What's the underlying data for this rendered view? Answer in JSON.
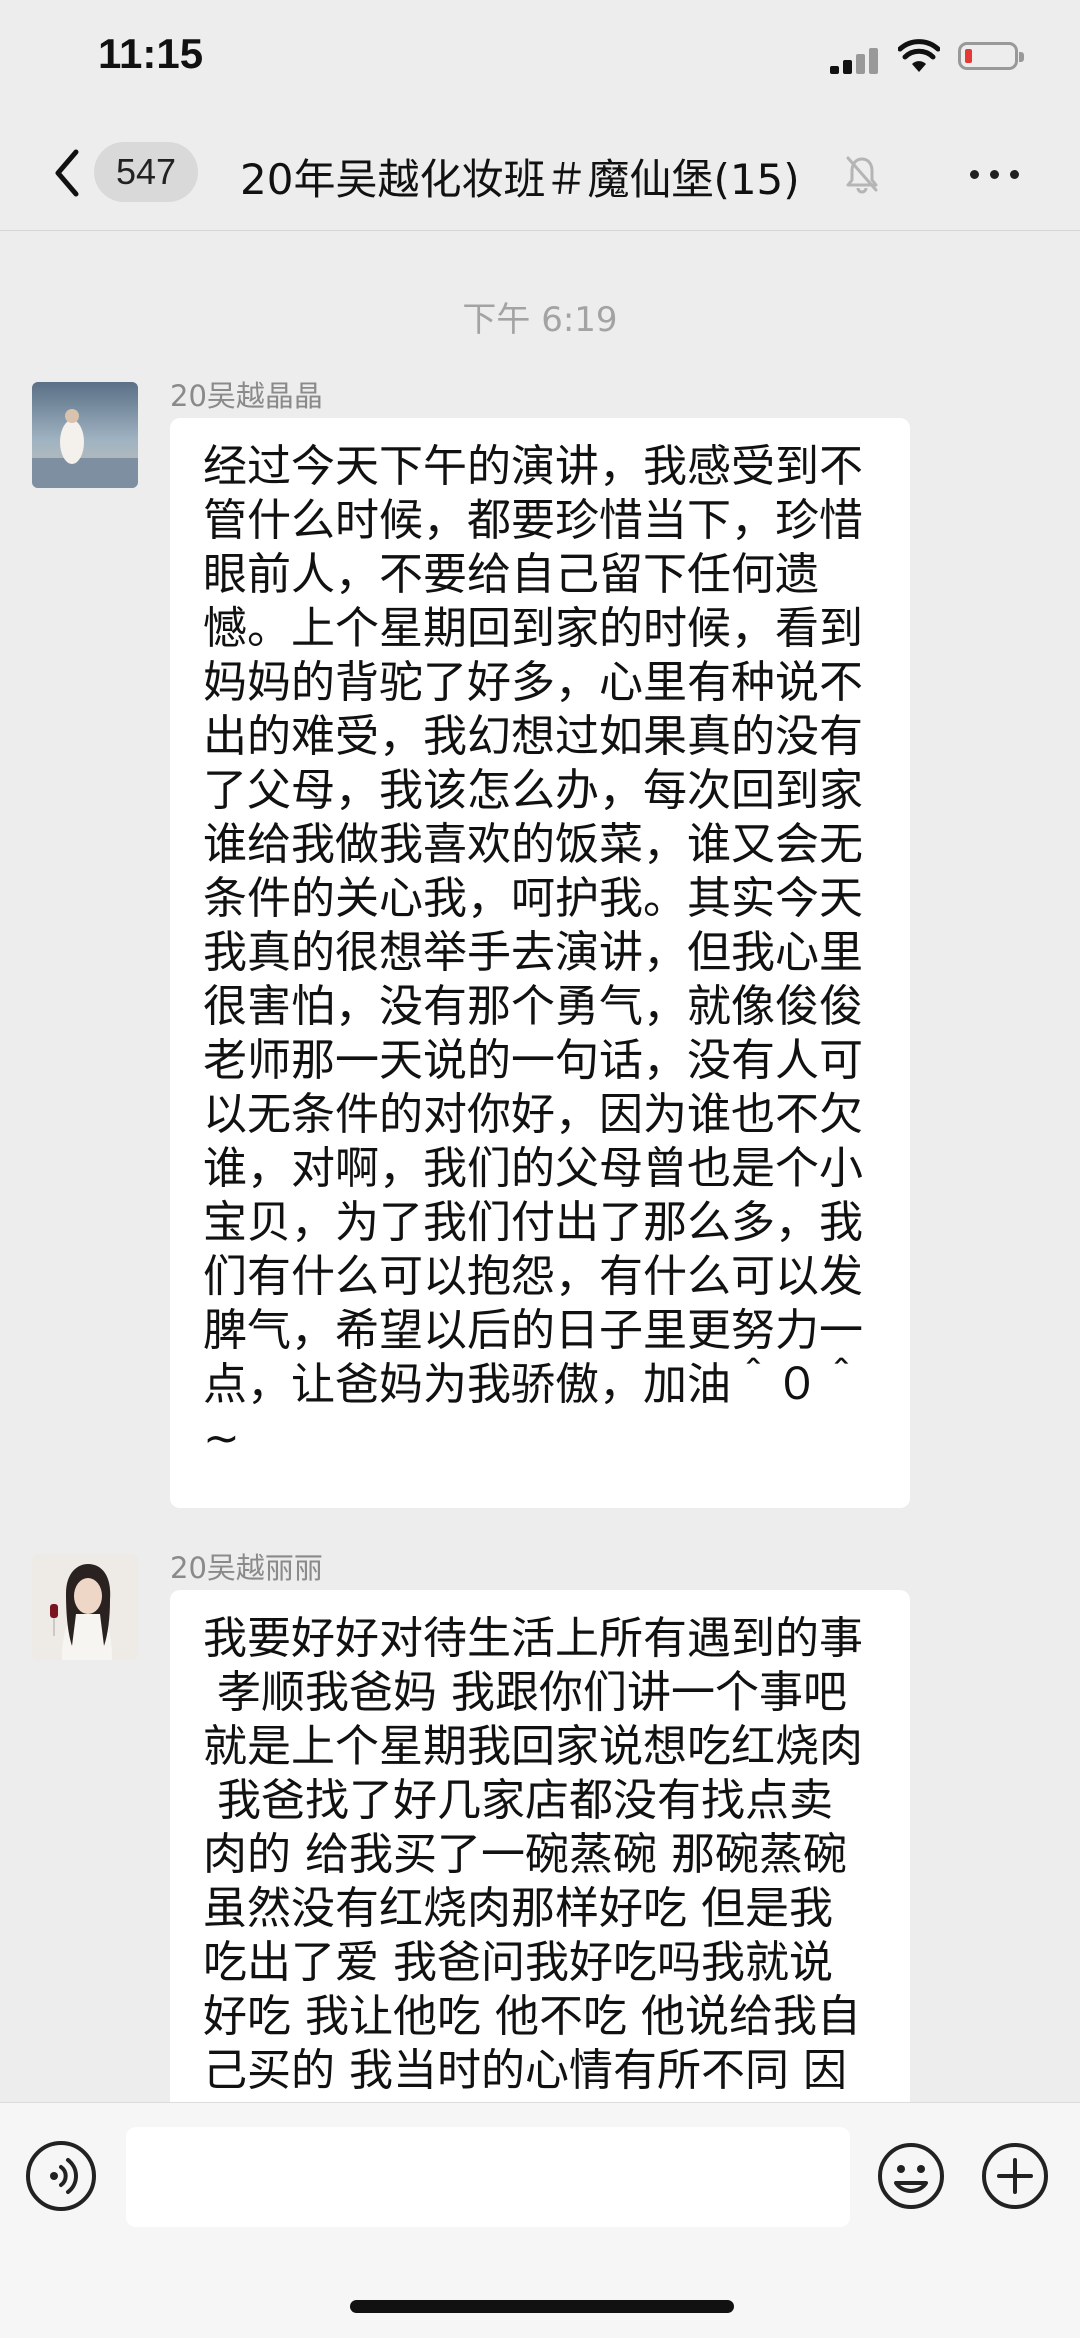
{
  "status_bar": {
    "time": "11:15"
  },
  "header": {
    "unread_count": "547",
    "title": "20年吴越化妆班＃魔仙堡(15)"
  },
  "messages": {
    "timestamp": "下午 6:19",
    "items": [
      {
        "sender": "20吴越晶晶",
        "lines": [
          "经过今天下午的演讲，我感受到不",
          "管什么时候，都要珍惜当下，珍惜",
          "眼前人，不要给自己留下任何遗",
          "憾。上个星期回到家的时候，看到",
          "妈妈的背驼了好多，心里有种说不",
          "出的难受，我幻想过如果真的没有",
          "了父母，我该怎么办，每次回到家",
          "谁给我做我喜欢的饭菜，谁又会无",
          "条件的关心我，呵护我。其实今天",
          "我真的很想举手去演讲，但我心里",
          "很害怕，没有那个勇气，就像俊俊",
          "老师那一天说的一句话，没有人可",
          "以无条件的对你好，因为谁也不欠",
          "谁，对啊，我们的父母曾也是个小",
          "宝贝，为了我们付出了那么多，我",
          "们有什么可以抱怨，有什么可以发",
          "脾气，希望以后的日子里更努力一",
          "点，让爸妈为我骄傲，加油＾０＾",
          "~"
        ]
      },
      {
        "sender": "20吴越丽丽",
        "lines": [
          "我要好好对待生活上所有遇到的事",
          " 孝顺我爸妈 我跟你们讲一个事吧",
          "就是上个星期我回家说想吃红烧肉",
          " 我爸找了好几家店都没有找点卖",
          "肉的 给我买了一碗蒸碗 那碗蒸碗",
          "虽然没有红烧肉那样好吃 但是我",
          "吃出了爱 我爸问我好吃吗我就说",
          "好吃 我让他吃 他不吃 他说给我自",
          "己买的 我当时的心情有所不同 因"
        ]
      }
    ]
  },
  "icons": {
    "back": "chevron-left-icon",
    "mute": "bell-off-icon",
    "more": "more-horizontal-icon",
    "voice": "voice-icon",
    "emoji": "smiley-icon",
    "plus": "plus-circle-icon"
  },
  "colors": {
    "background": "#ededed",
    "bubble": "#ffffff",
    "battery_low": "#e53935"
  }
}
